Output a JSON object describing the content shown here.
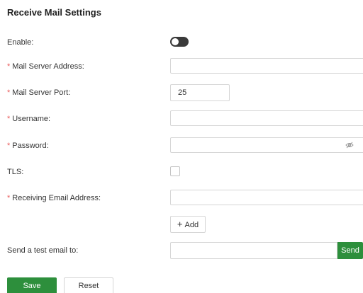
{
  "section": {
    "title": "Receive Mail Settings"
  },
  "fields": {
    "enable": {
      "label": "Enable",
      "colon": ":",
      "enabled": false
    },
    "mail_server_address": {
      "label": "Mail Server Address",
      "colon": ":",
      "required": "*",
      "value": ""
    },
    "mail_server_port": {
      "label": "Mail Server Port",
      "colon": ":",
      "required": "*",
      "value": "25"
    },
    "username": {
      "label": "Username",
      "colon": ":",
      "required": "*",
      "value": ""
    },
    "password": {
      "label": "Password",
      "colon": ":",
      "required": "*",
      "value": "",
      "icon": "eye-hidden-icon"
    },
    "tls": {
      "label": "TLS",
      "colon": ":",
      "checked": false
    },
    "receiving_email_address": {
      "label": "Receiving Email Address",
      "colon": ":",
      "required": "*",
      "value": ""
    }
  },
  "add_button": {
    "icon": "+",
    "label": "Add"
  },
  "test_email": {
    "label": "Send a test email to",
    "colon": ":",
    "value": "",
    "send_label": "Send"
  },
  "actions": {
    "save_label": "Save",
    "reset_label": "Reset"
  },
  "colors": {
    "accent": "#2d8f3c",
    "required": "#e95b5b",
    "toggle_off": "#3a3a3a",
    "border": "#d6d6d6"
  }
}
